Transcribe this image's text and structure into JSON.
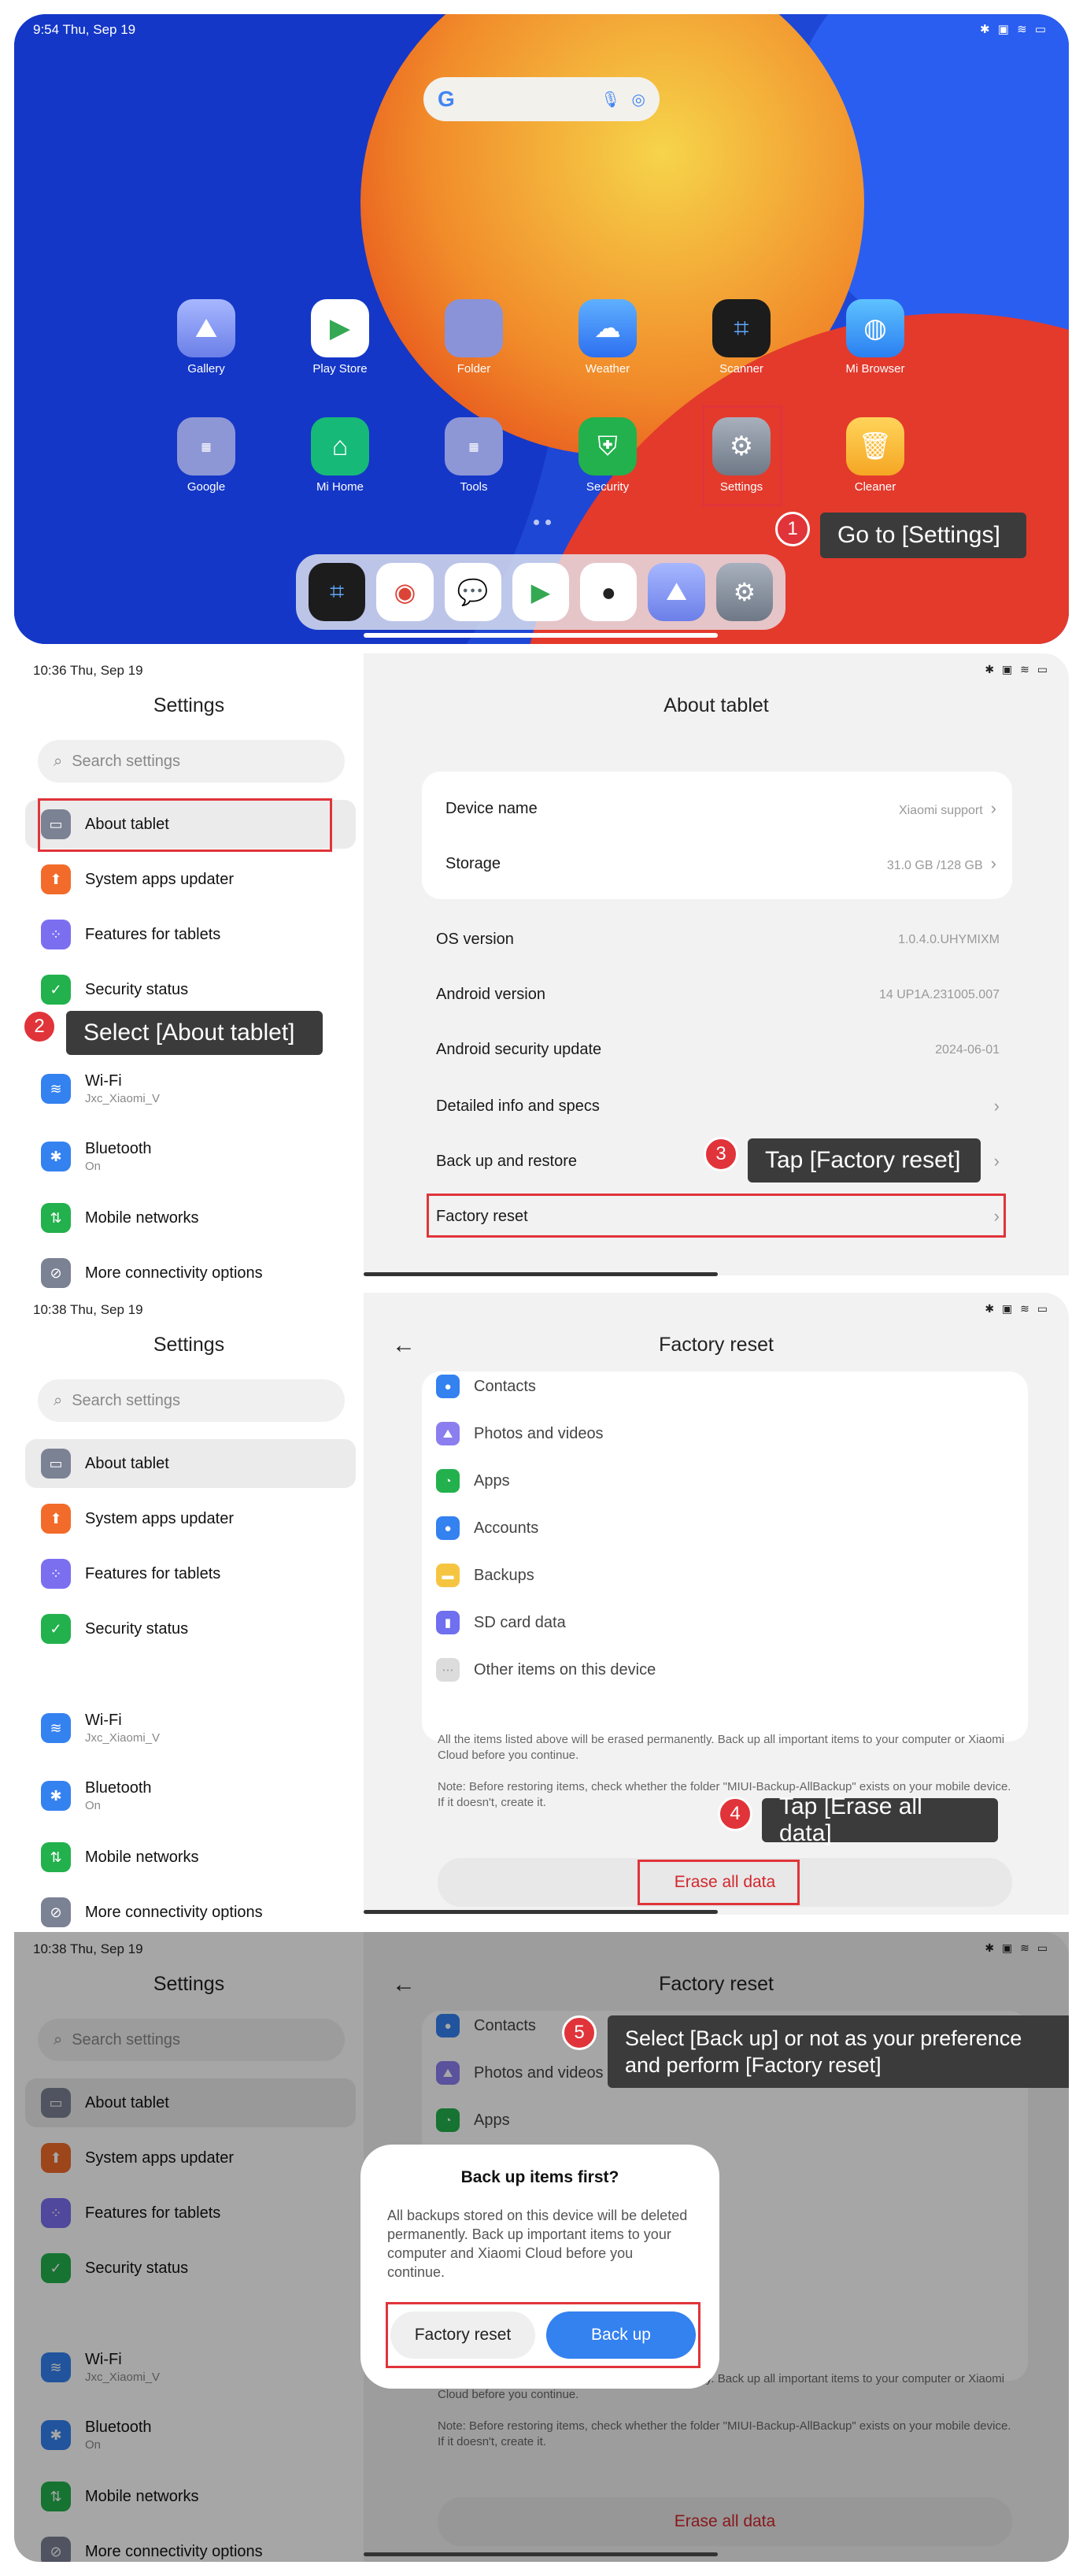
{
  "panel1": {
    "time": "9:54  Thu, Sep 19",
    "status_icons": "✱ ▣ ≋ ▭",
    "search": {
      "logo": "G",
      "mic_icon": "mic-icon",
      "lens_icon": "lens-icon"
    },
    "apps_row1": [
      {
        "label": "Gallery",
        "icon": "gallery-icon",
        "color": "#7d8cf0"
      },
      {
        "label": "Play Store",
        "icon": "play-store-icon",
        "color": "#ffffff"
      },
      {
        "label": "Folder",
        "icon": "folder-icon",
        "color": "#8a93d8"
      },
      {
        "label": "Weather",
        "icon": "weather-icon",
        "color": "#3f8cf2"
      },
      {
        "label": "Scanner",
        "icon": "scanner-icon",
        "color": "#1c1c1c"
      },
      {
        "label": "Mi Browser",
        "icon": "browser-icon",
        "color": "#2f8ff5"
      }
    ],
    "apps_row2": [
      {
        "label": "Google",
        "icon": "google-folder-icon",
        "color": "#8d97d6"
      },
      {
        "label": "Mi Home",
        "icon": "mi-home-icon",
        "color": "#17b978"
      },
      {
        "label": "Tools",
        "icon": "tools-folder-icon",
        "color": "#8d97d6"
      },
      {
        "label": "Security",
        "icon": "security-icon",
        "color": "#22b14c"
      },
      {
        "label": "Settings",
        "icon": "settings-icon",
        "color": "#8c95a6"
      },
      {
        "label": "Cleaner",
        "icon": "cleaner-icon",
        "color": "#f5a623"
      }
    ],
    "callout": "Go to [Settings]",
    "step": "1"
  },
  "panel2": {
    "time": "10:36   Thu, Sep 19",
    "status_icons": "✱ ▣ ≋ ▭",
    "sidebar_title": "Settings",
    "search_placeholder": "Search settings",
    "items": [
      {
        "label": "About tablet",
        "sub": ""
      },
      {
        "label": "System apps updater",
        "sub": ""
      },
      {
        "label": "Features for tablets",
        "sub": ""
      },
      {
        "label": "Security status",
        "sub": ""
      },
      {
        "label": "Wi-Fi",
        "sub": "Jxc_Xiaomi_V"
      },
      {
        "label": "Bluetooth",
        "sub": "On"
      },
      {
        "label": "Mobile networks",
        "sub": ""
      },
      {
        "label": "More connectivity options",
        "sub": ""
      }
    ],
    "main_title": "About tablet",
    "device_name_label": "Device name",
    "device_name_value": "Xiaomi support",
    "storage_label": "Storage",
    "storage_value": "31.0 GB /128 GB",
    "rows": [
      {
        "label": "OS version",
        "value": "1.0.4.0.UHYMIXM"
      },
      {
        "label": "Android version",
        "value": "14 UP1A.231005.007"
      },
      {
        "label": "Android security update",
        "value": "2024-06-01"
      },
      {
        "label": "Detailed info and specs",
        "value": ""
      },
      {
        "label": "Back up and restore",
        "value": ""
      },
      {
        "label": "Factory reset",
        "value": ""
      }
    ],
    "callout_about": "Select [About tablet]",
    "step_about": "2",
    "callout_reset": "Tap [Factory reset]",
    "step_reset": "3"
  },
  "panel3": {
    "time": "10:38   Thu, Sep 19",
    "main_title": "Factory reset",
    "reset_items": [
      "Contacts",
      "Photos and videos",
      "Apps",
      "Accounts",
      "Backups",
      "SD card data",
      "Other items on this device"
    ],
    "note1": "All the items listed above will be erased permanently. Back up all important items to your computer or Xiaomi Cloud before you continue.",
    "note2": "Note: Before restoring items, check whether the folder \"MIUI-Backup-AllBackup\" exists on your mobile device. If it doesn't, create it.",
    "erase_label": "Erase all data",
    "callout": "Tap [Erase all data]",
    "step": "4"
  },
  "panel4": {
    "time": "10:38   Thu, Sep 19",
    "dialog_title": "Back up items first?",
    "dialog_body": "All backups stored on this device will be deleted permanently. Back up important items to your computer and Xiaomi Cloud before you continue.",
    "btn_reset": "Factory reset",
    "btn_backup": "Back up",
    "callout_line1": "Select [Back up] or not as your preference",
    "callout_line2": "and perform [Factory reset]",
    "step": "5"
  },
  "colors": {
    "accent_red": "#e0343a",
    "primary_blue": "#3481f0",
    "callout_bg": "#3b3b3b"
  }
}
